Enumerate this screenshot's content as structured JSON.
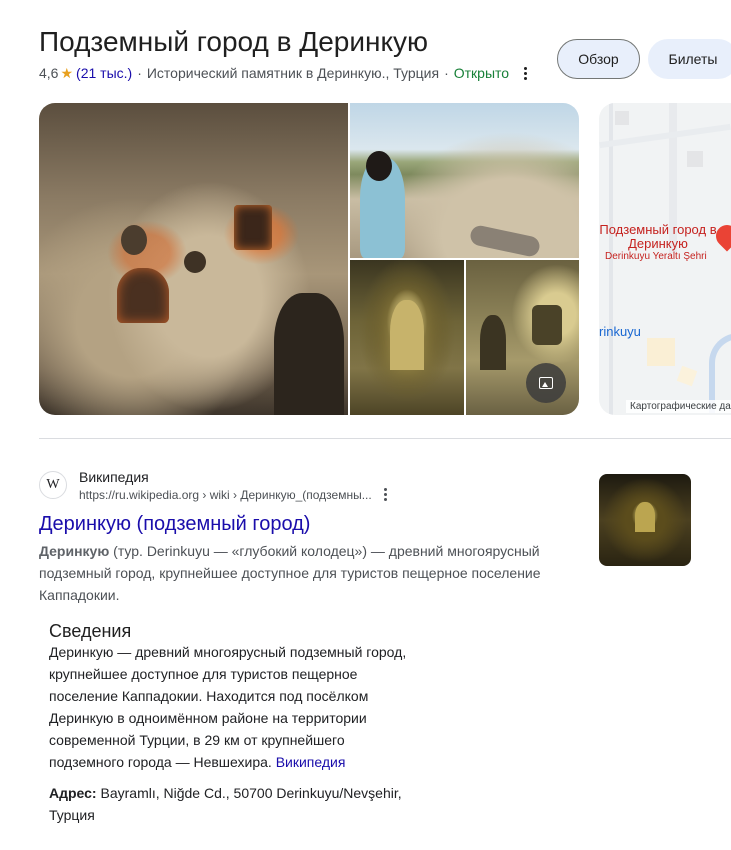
{
  "header": {
    "title": "Подземный город в Деринкую",
    "rating": "4,6",
    "reviews": "(21 тыс.)",
    "category": "Исторический памятник в Деринкую., Турция",
    "status": "Открыто",
    "buttons": {
      "overview": "Обзор",
      "tickets": "Билеты"
    }
  },
  "map": {
    "pin_label": "Подземный город в Деринкую",
    "pin_sublabel": "Derinkuyu Yeraltı Şehri",
    "town_label": "rinkuyu",
    "attribution": "Картографические да"
  },
  "result": {
    "source_name": "Википедия",
    "favicon": "W",
    "url": "https://ru.wikipedia.org › wiki › Деринкую_(подземны...",
    "title": "Деринкую (подземный город)",
    "snippet_bold": "Деринкую",
    "snippet_rest": " (тур. Derinkuyu — «глубокий колодец») — древний многоярусный подземный город, крупнейшее доступное для туристов пещерное поселение Каппадокии."
  },
  "info": {
    "title": "Сведения",
    "text": "Деринкую — древний многоярусный подземный город, крупнейшее доступное для туристов пещерное поселение Каппадокии. Находится под посёлком Деринкую в одноимённом районе на территории современной Турции, в 29 км от крупнейшего подземного города — Невшехира. ",
    "wiki_link": "Википедия",
    "address_label": "Адрес:",
    "address_value": " Bayramlı, Niğde Cd., 50700 Derinkuyu/Nevşehir, Турция"
  },
  "colors": {
    "link": "#1a0dab",
    "open": "#188038",
    "star": "#e8a01e",
    "button_bg": "#e8effb",
    "pin": "#c5221f"
  }
}
